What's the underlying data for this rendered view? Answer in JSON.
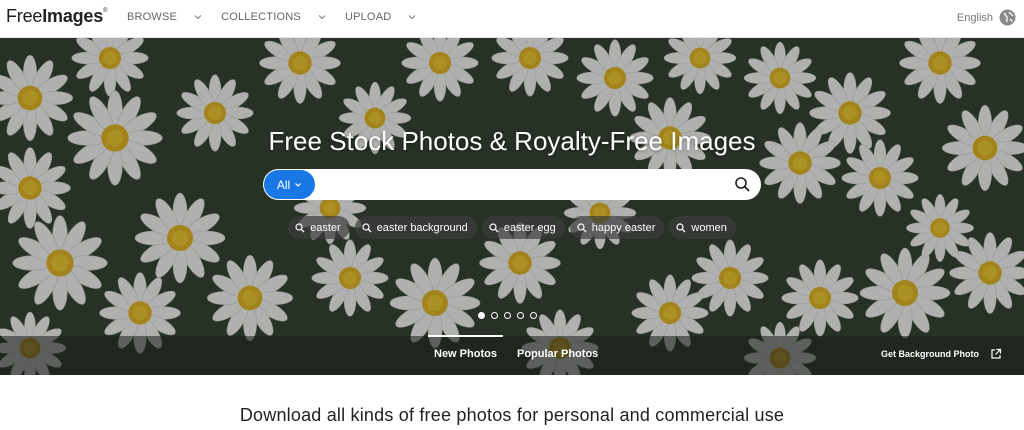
{
  "header": {
    "logo_text_light": "Free",
    "logo_text_bold": "Images",
    "logo_mark": "®",
    "nav": [
      {
        "label": "BROWSE"
      },
      {
        "label": "COLLECTIONS"
      },
      {
        "label": "UPLOAD"
      }
    ],
    "language": "English"
  },
  "hero": {
    "title": "Free Stock Photos & Royalty-Free Images",
    "search": {
      "category": "All",
      "value": "",
      "placeholder": ""
    },
    "tags": [
      "easter",
      "easter background",
      "easter egg",
      "happy easter",
      "women"
    ],
    "carousel": {
      "count": 5,
      "active": 0
    },
    "tabs": [
      {
        "label": "New Photos",
        "active": true
      },
      {
        "label": "Popular Photos",
        "active": false
      }
    ],
    "get_background_label": "Get Background Photo"
  },
  "subtitle": "Download all kinds of free photos for personal and commercial use",
  "colors": {
    "accent": "#1a78e6",
    "daisy_petal": "#f2f2f0",
    "daisy_center": "#e3b520",
    "foliage": "#2e3a2c"
  }
}
